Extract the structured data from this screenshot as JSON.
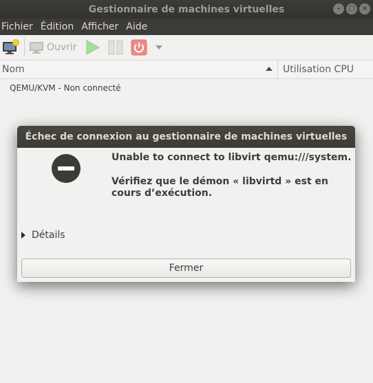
{
  "window": {
    "title": "Gestionnaire de machines virtuelles",
    "controls": {
      "minimize": "–",
      "maximize": "□",
      "close": "×"
    }
  },
  "menubar": {
    "items": [
      {
        "label": "Fichier"
      },
      {
        "label": "Édition"
      },
      {
        "label": "Afficher"
      },
      {
        "label": "Aide"
      }
    ]
  },
  "toolbar": {
    "open_label": "Ouvrir",
    "icons": [
      "new-vm-icon",
      "monitor-icon",
      "play-icon",
      "pause-icon",
      "power-icon",
      "dropdown-arrow-icon"
    ],
    "colors": {
      "play": "#8fd18b",
      "pause": "#c9c6c1",
      "power": "#e57373"
    }
  },
  "vm_list": {
    "columns": [
      {
        "label": "Nom",
        "sort": "ascending"
      },
      {
        "label": "Utilisation CPU"
      }
    ],
    "connection": "QEMU/KVM - Non connecté"
  },
  "dialog": {
    "title": "Échec de connexion au gestionnaire de machines virtuelles",
    "icon": "error-icon",
    "primary_text": "Unable to connect to libvirt qemu:///system.",
    "secondary_text": "Vérifiez que le démon « libvirtd » est en cours d’exécution.",
    "details_label": "Détails",
    "close_label": "Fermer"
  }
}
